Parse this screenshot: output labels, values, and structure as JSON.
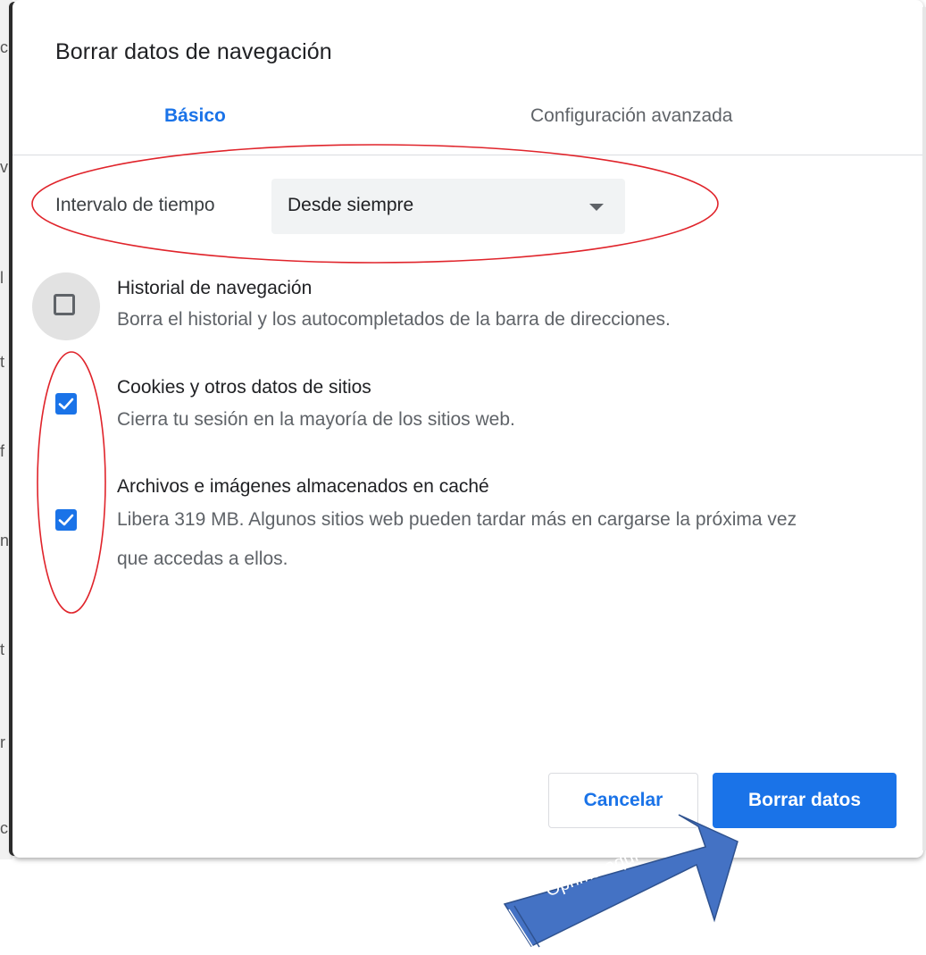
{
  "dialog": {
    "title": "Borrar datos de navegación",
    "tabs": [
      {
        "label": "Básico",
        "active": true
      },
      {
        "label": "Configuración avanzada",
        "active": false
      }
    ]
  },
  "time_range": {
    "label": "Intervalo de tiempo",
    "selected": "Desde siempre"
  },
  "options": [
    {
      "title": "Historial de navegación",
      "description": "Borra el historial y los autocompletados de la barra de direcciones.",
      "checked": false
    },
    {
      "title": "Cookies y otros datos de sitios",
      "description": "Cierra tu sesión en la mayoría de los sitios web.",
      "checked": true
    },
    {
      "title": "Archivos e imágenes almacenados en caché",
      "description": "Libera 319 MB. Algunos sitios web pueden tardar más en cargarse la próxima vez que accedas a ellos.",
      "checked": true
    }
  ],
  "buttons": {
    "cancel": "Cancelar",
    "clear": "Borrar datos"
  },
  "annotation": {
    "arrow_text": "Oprima aquí",
    "ellipse_color": "#e0242b",
    "arrow_color": "#4472c4"
  },
  "colors": {
    "accent": "#1a73e8",
    "text_primary": "#202124",
    "text_secondary": "#5f6368"
  }
}
